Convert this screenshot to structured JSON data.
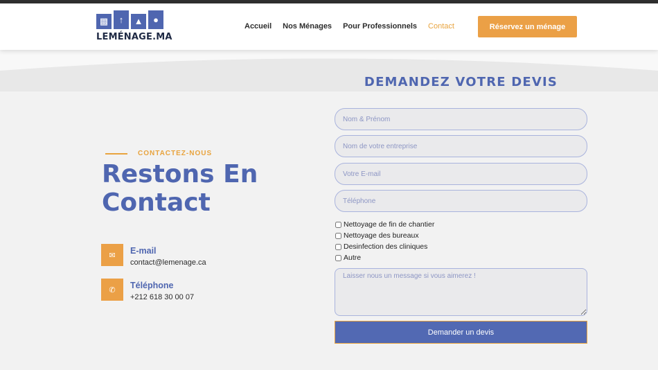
{
  "brand": {
    "name": "LEMÉNAGE.MA"
  },
  "nav": {
    "items": [
      {
        "label": "Accueil",
        "active": false
      },
      {
        "label": "Nos Ménages",
        "active": false
      },
      {
        "label": "Pour Professionnels",
        "active": false
      },
      {
        "label": "Contact",
        "active": true
      }
    ],
    "cta_label": "Réservez un ménage"
  },
  "contact": {
    "eyebrow": "CONTACTEZ-NOUS",
    "title_line1": "Restons En",
    "title_line2": "Contact",
    "email_label": "E-mail",
    "email_value": "contact@lemenage.ca",
    "phone_label": "Téléphone",
    "phone_value": "+212 618 30 00 07"
  },
  "form": {
    "title": "DEMANDEZ VOTRE DEVIS",
    "name_placeholder": "Nom & Prénom",
    "company_placeholder": "Nom de votre entreprise",
    "email_placeholder": "Votre E-mail",
    "phone_placeholder": "Téléphone",
    "services": [
      "Nettoyage de fin de chantier",
      "Nettoyage des bureaux",
      "Desinfection des cliniques",
      "Autre"
    ],
    "message_placeholder": "Laisser nous un message si vous aimerez !",
    "submit_label": "Demander un devis"
  },
  "colors": {
    "brand_blue": "#4f66b0",
    "accent_orange": "#eba046",
    "button_blue": "#5269b3"
  },
  "icons": {
    "email": "envelope-icon",
    "phone": "phone-icon"
  }
}
